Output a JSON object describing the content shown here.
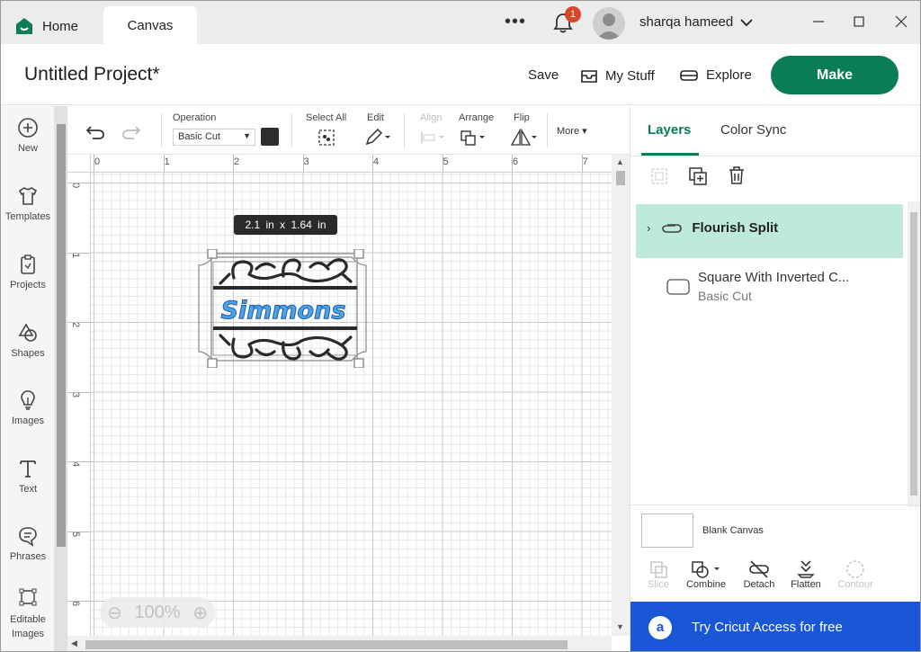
{
  "titlebar": {
    "home_tab": "Home",
    "canvas_tab": "Canvas",
    "notification_count": "1",
    "user_name": "sharqa hameed"
  },
  "header": {
    "project_title": "Untitled Project*",
    "save": "Save",
    "my_stuff": "My Stuff",
    "explore": "Explore",
    "make": "Make"
  },
  "sidebar": {
    "items": [
      {
        "label": "New",
        "icon": "plus-circle-icon"
      },
      {
        "label": "Templates",
        "icon": "shirt-icon"
      },
      {
        "label": "Projects",
        "icon": "clipboard-icon"
      },
      {
        "label": "Shapes",
        "icon": "shapes-icon"
      },
      {
        "label": "Images",
        "icon": "lightbulb-icon"
      },
      {
        "label": "Text",
        "icon": "text-icon"
      },
      {
        "label": "Phrases",
        "icon": "speech-bubble-icon"
      },
      {
        "label": "Editable Images",
        "icon": "node-edit-icon"
      }
    ]
  },
  "toolbar": {
    "operation_label": "Operation",
    "operation_value": "Basic Cut",
    "select_all": "Select All",
    "edit": "Edit",
    "align": "Align",
    "arrange": "Arrange",
    "flip": "Flip",
    "more": "More"
  },
  "canvas": {
    "ruler_top": [
      "0",
      "1",
      "2",
      "3",
      "4",
      "5",
      "6",
      "7"
    ],
    "ruler_left": [
      "0",
      "1",
      "2",
      "3",
      "4",
      "5",
      "6"
    ],
    "size_tooltip": "2.1 in x 1.64 in",
    "design_text": "Simmons",
    "zoom": "100%"
  },
  "right_panel": {
    "tab_layers": "Layers",
    "tab_color_sync": "Color Sync",
    "layers": [
      {
        "name": "Flourish Split",
        "selected": true
      },
      {
        "name": "Square With Inverted C...",
        "sub": "Basic Cut"
      }
    ],
    "blank_canvas": "Blank Canvas",
    "tools": [
      {
        "label": "Slice",
        "enabled": false
      },
      {
        "label": "Combine",
        "enabled": true
      },
      {
        "label": "Detach",
        "enabled": true
      },
      {
        "label": "Flatten",
        "enabled": true
      },
      {
        "label": "Contour",
        "enabled": false
      }
    ],
    "access_banner": "Try Cricut Access for free"
  },
  "colors": {
    "brand_green": "#0a7d54",
    "layer_highlight": "#bdeadc",
    "access_blue": "#1a57d6",
    "badge_red": "#d9472b"
  }
}
